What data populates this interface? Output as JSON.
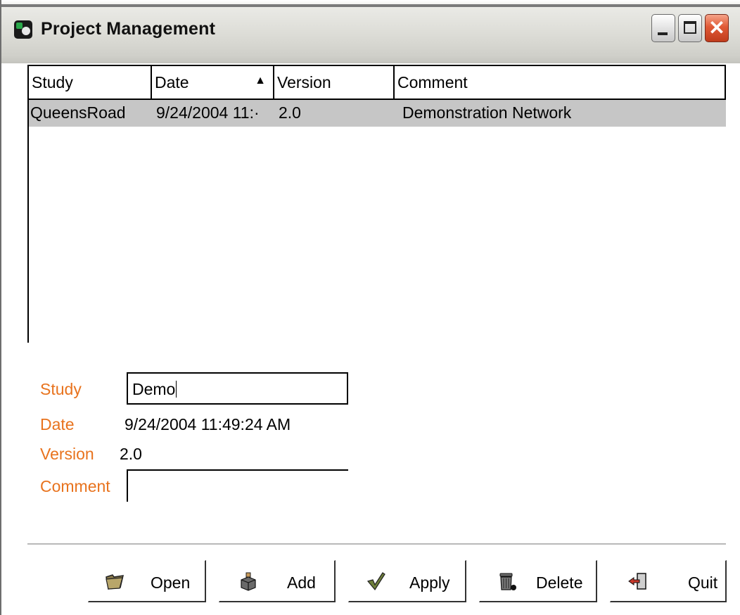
{
  "window": {
    "title": "Project Management"
  },
  "table": {
    "columns": [
      "Study",
      "Date",
      "Version",
      "Comment"
    ],
    "sort_indicator": "▲",
    "rows": [
      {
        "study": "QueensRoad",
        "date": "9/24/2004 11:·",
        "version": "2.0",
        "comment": "Demonstration Network"
      }
    ]
  },
  "form": {
    "study_label": "Study",
    "study_value": "Demo",
    "date_label": "Date",
    "date_value": "9/24/2004 11:49:24 AM",
    "version_label": "Version",
    "version_value": "2.0",
    "comment_label": "Comment",
    "comment_value": ""
  },
  "buttons": {
    "open": "Open",
    "add": "Add",
    "apply": "Apply",
    "delete": "Delete",
    "quit": "Quit"
  },
  "icons": {
    "app": "app-icon",
    "open": "folder-icon",
    "add": "box-add-icon",
    "apply": "checkmark-icon",
    "delete": "trash-can-icon",
    "quit": "exit-door-icon"
  },
  "colors": {
    "label": "#e8731e",
    "selected_row": "#c6c6c6"
  }
}
